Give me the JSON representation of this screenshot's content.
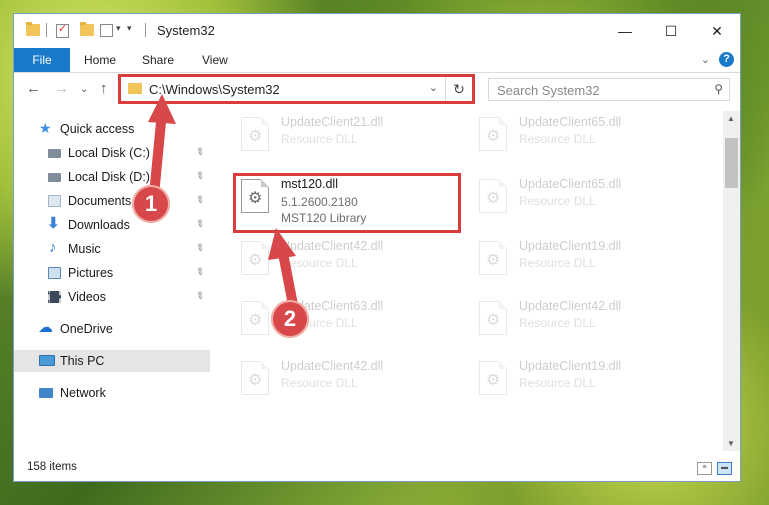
{
  "window": {
    "title": "System32"
  },
  "window_controls": {
    "minimize": "—",
    "maximize": "☐",
    "close": "✕"
  },
  "ribbon": {
    "tabs": [
      "File",
      "Home",
      "Share",
      "View"
    ],
    "collapse_glyph": "⌄",
    "help_glyph": "?"
  },
  "nav": {
    "back": "←",
    "forward": "→",
    "recent": "⌄",
    "up": "↑"
  },
  "address": {
    "path": "C:\\Windows\\System32",
    "dropdown": "⌄",
    "refresh": "↻"
  },
  "search": {
    "placeholder": "Search System32",
    "icon": "search-icon"
  },
  "sidebar": {
    "items": [
      {
        "label": "Quick access",
        "icon": "star-icon",
        "color": "#3d8ee8",
        "pinned": false
      },
      {
        "label": "Local Disk (C:)",
        "icon": "drive-icon",
        "color": "#7f8c99",
        "pinned": true
      },
      {
        "label": "Local Disk (D:)",
        "icon": "drive-icon",
        "color": "#7f8c99",
        "pinned": true
      },
      {
        "label": "Documents",
        "icon": "documents-icon",
        "color": "#9fb6cc",
        "pinned": true
      },
      {
        "label": "Downloads",
        "icon": "downloads-icon",
        "color": "#3b82d4",
        "pinned": true
      },
      {
        "label": "Music",
        "icon": "music-icon",
        "color": "#2e7bd6",
        "pinned": true
      },
      {
        "label": "Pictures",
        "icon": "pictures-icon",
        "color": "#5b87b5",
        "pinned": true
      },
      {
        "label": "Videos",
        "icon": "videos-icon",
        "color": "#3a4a5a",
        "pinned": true
      },
      {
        "label": "OneDrive",
        "icon": "cloud-icon",
        "color": "#1c6fd1",
        "pinned": false
      },
      {
        "label": "This PC",
        "icon": "computer-icon",
        "color": "#4a9ad8",
        "pinned": false,
        "selected": true
      },
      {
        "label": "Network",
        "icon": "network-icon",
        "color": "#3e85c9",
        "pinned": false
      }
    ],
    "pin_glyph": "📌"
  },
  "files": {
    "left_column": [
      {
        "name": "UpdateClient21.dll",
        "type": "Resource DLL"
      },
      {
        "name": "mst120.dll",
        "version": "5.1.2600.2180",
        "description": "MST120 Library",
        "selected": true
      },
      {
        "name": "UpdateClient42.dll",
        "type": "Resource DLL"
      },
      {
        "name": "UpdateClient63.dll",
        "type": "Resource DLL"
      },
      {
        "name": "UpdateClient42.dll",
        "type": "Resource DLL"
      }
    ],
    "right_column": [
      {
        "name": "UpdateClient65.dll",
        "type": "Resource DLL"
      },
      {
        "name": "UpdateClient65.dll",
        "type": "Resource DLL"
      },
      {
        "name": "UpdateClient19.dll",
        "type": "Resource DLL"
      },
      {
        "name": "UpdateClient42.dll",
        "type": "Resource DLL"
      },
      {
        "name": "UpdateClient19.dll",
        "type": "Resource DLL"
      }
    ]
  },
  "status": {
    "item_count": "158 items"
  },
  "annotations": {
    "callout_1": "1",
    "callout_2": "2",
    "highlight_color": "#d83c3c",
    "callout_color": "#d8484a"
  },
  "scrollbar": {
    "up": "▲",
    "down": "▼"
  }
}
